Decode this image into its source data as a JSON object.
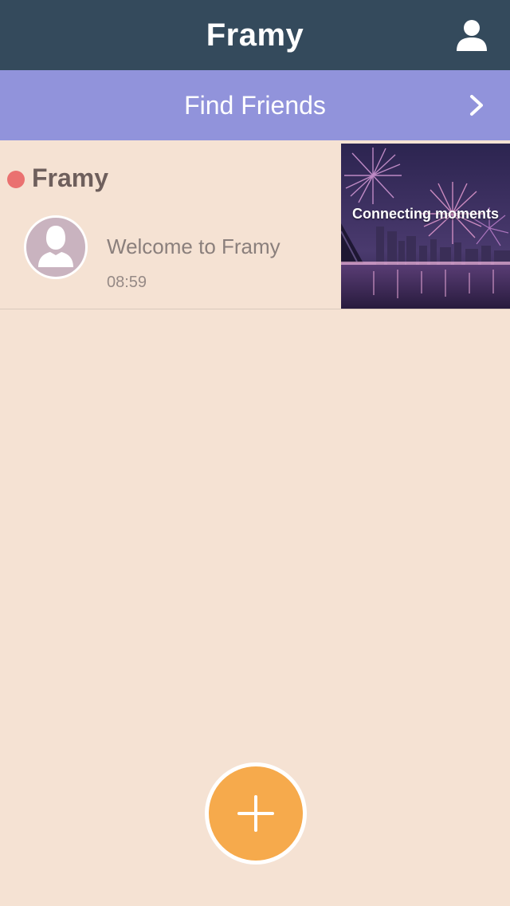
{
  "navbar": {
    "title": "Framy",
    "profile_icon": "user-icon"
  },
  "find_friends": {
    "label": "Find Friends",
    "icon": "chevron-right-icon"
  },
  "feed": [
    {
      "group_name": "Framy",
      "unread_dot_color": "#ea7170",
      "avatar_icon": "default-avatar-icon",
      "message": "Welcome to Framy",
      "time": "08:59",
      "thumbnail_caption": "Connecting moments"
    }
  ],
  "fab": {
    "icon": "plus-icon"
  },
  "colors": {
    "navbar": "#344a5c",
    "find_bar": "#9193db",
    "background": "#f5e2d3",
    "fab": "#f6aa4c"
  }
}
